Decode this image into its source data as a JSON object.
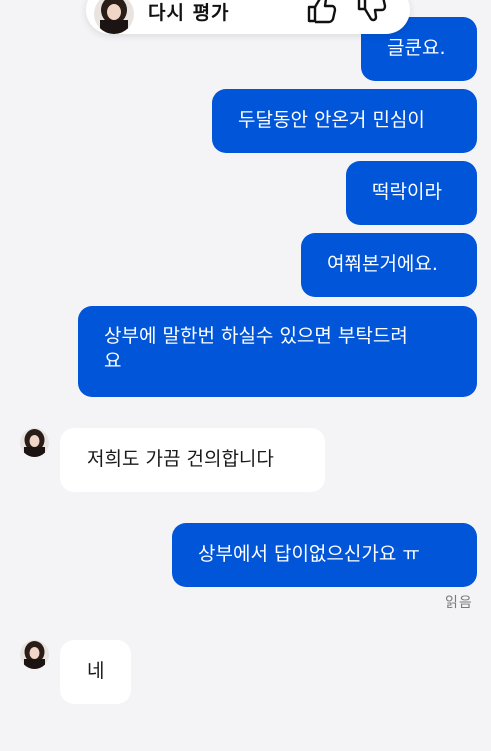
{
  "rating": {
    "label": "다시 평가",
    "thumb_up_icon": "thumbs-up-icon",
    "thumb_down_icon": "thumbs-down-icon"
  },
  "messages": [
    {
      "sender": "me",
      "text": "글쿤요."
    },
    {
      "sender": "me",
      "text": "두달동안 안온거 민심이"
    },
    {
      "sender": "me",
      "text": "떡락이라"
    },
    {
      "sender": "me",
      "text": "여쭤본거에요."
    },
    {
      "sender": "me",
      "text": "상부에 말한번 하실수 있으면 부탁드려\n요"
    },
    {
      "sender": "agent",
      "text": "저희도 가끔 건의합니다"
    },
    {
      "sender": "me",
      "text": "상부에서 답이없으신가요 ㅠ"
    },
    {
      "sender": "agent",
      "text": "네"
    }
  ],
  "read_status": "읽음",
  "colors": {
    "outgoing": "#0055d9",
    "incoming": "#ffffff",
    "background": "#f4f4f7"
  }
}
